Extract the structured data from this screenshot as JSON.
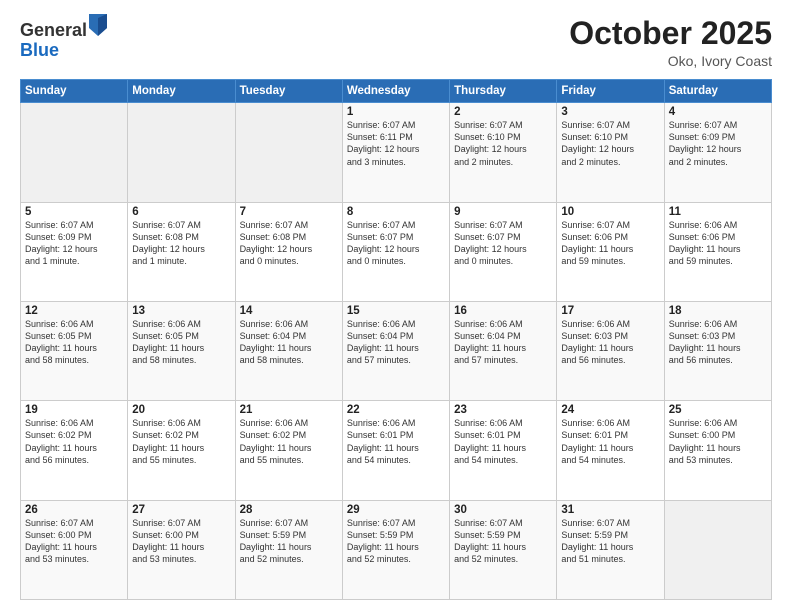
{
  "header": {
    "logo_general": "General",
    "logo_blue": "Blue",
    "month": "October 2025",
    "location": "Oko, Ivory Coast"
  },
  "days_of_week": [
    "Sunday",
    "Monday",
    "Tuesday",
    "Wednesday",
    "Thursday",
    "Friday",
    "Saturday"
  ],
  "weeks": [
    [
      {
        "day": "",
        "info": ""
      },
      {
        "day": "",
        "info": ""
      },
      {
        "day": "",
        "info": ""
      },
      {
        "day": "1",
        "info": "Sunrise: 6:07 AM\nSunset: 6:11 PM\nDaylight: 12 hours\nand 3 minutes."
      },
      {
        "day": "2",
        "info": "Sunrise: 6:07 AM\nSunset: 6:10 PM\nDaylight: 12 hours\nand 2 minutes."
      },
      {
        "day": "3",
        "info": "Sunrise: 6:07 AM\nSunset: 6:10 PM\nDaylight: 12 hours\nand 2 minutes."
      },
      {
        "day": "4",
        "info": "Sunrise: 6:07 AM\nSunset: 6:09 PM\nDaylight: 12 hours\nand 2 minutes."
      }
    ],
    [
      {
        "day": "5",
        "info": "Sunrise: 6:07 AM\nSunset: 6:09 PM\nDaylight: 12 hours\nand 1 minute."
      },
      {
        "day": "6",
        "info": "Sunrise: 6:07 AM\nSunset: 6:08 PM\nDaylight: 12 hours\nand 1 minute."
      },
      {
        "day": "7",
        "info": "Sunrise: 6:07 AM\nSunset: 6:08 PM\nDaylight: 12 hours\nand 0 minutes."
      },
      {
        "day": "8",
        "info": "Sunrise: 6:07 AM\nSunset: 6:07 PM\nDaylight: 12 hours\nand 0 minutes."
      },
      {
        "day": "9",
        "info": "Sunrise: 6:07 AM\nSunset: 6:07 PM\nDaylight: 12 hours\nand 0 minutes."
      },
      {
        "day": "10",
        "info": "Sunrise: 6:07 AM\nSunset: 6:06 PM\nDaylight: 11 hours\nand 59 minutes."
      },
      {
        "day": "11",
        "info": "Sunrise: 6:06 AM\nSunset: 6:06 PM\nDaylight: 11 hours\nand 59 minutes."
      }
    ],
    [
      {
        "day": "12",
        "info": "Sunrise: 6:06 AM\nSunset: 6:05 PM\nDaylight: 11 hours\nand 58 minutes."
      },
      {
        "day": "13",
        "info": "Sunrise: 6:06 AM\nSunset: 6:05 PM\nDaylight: 11 hours\nand 58 minutes."
      },
      {
        "day": "14",
        "info": "Sunrise: 6:06 AM\nSunset: 6:04 PM\nDaylight: 11 hours\nand 58 minutes."
      },
      {
        "day": "15",
        "info": "Sunrise: 6:06 AM\nSunset: 6:04 PM\nDaylight: 11 hours\nand 57 minutes."
      },
      {
        "day": "16",
        "info": "Sunrise: 6:06 AM\nSunset: 6:04 PM\nDaylight: 11 hours\nand 57 minutes."
      },
      {
        "day": "17",
        "info": "Sunrise: 6:06 AM\nSunset: 6:03 PM\nDaylight: 11 hours\nand 56 minutes."
      },
      {
        "day": "18",
        "info": "Sunrise: 6:06 AM\nSunset: 6:03 PM\nDaylight: 11 hours\nand 56 minutes."
      }
    ],
    [
      {
        "day": "19",
        "info": "Sunrise: 6:06 AM\nSunset: 6:02 PM\nDaylight: 11 hours\nand 56 minutes."
      },
      {
        "day": "20",
        "info": "Sunrise: 6:06 AM\nSunset: 6:02 PM\nDaylight: 11 hours\nand 55 minutes."
      },
      {
        "day": "21",
        "info": "Sunrise: 6:06 AM\nSunset: 6:02 PM\nDaylight: 11 hours\nand 55 minutes."
      },
      {
        "day": "22",
        "info": "Sunrise: 6:06 AM\nSunset: 6:01 PM\nDaylight: 11 hours\nand 54 minutes."
      },
      {
        "day": "23",
        "info": "Sunrise: 6:06 AM\nSunset: 6:01 PM\nDaylight: 11 hours\nand 54 minutes."
      },
      {
        "day": "24",
        "info": "Sunrise: 6:06 AM\nSunset: 6:01 PM\nDaylight: 11 hours\nand 54 minutes."
      },
      {
        "day": "25",
        "info": "Sunrise: 6:06 AM\nSunset: 6:00 PM\nDaylight: 11 hours\nand 53 minutes."
      }
    ],
    [
      {
        "day": "26",
        "info": "Sunrise: 6:07 AM\nSunset: 6:00 PM\nDaylight: 11 hours\nand 53 minutes."
      },
      {
        "day": "27",
        "info": "Sunrise: 6:07 AM\nSunset: 6:00 PM\nDaylight: 11 hours\nand 53 minutes."
      },
      {
        "day": "28",
        "info": "Sunrise: 6:07 AM\nSunset: 5:59 PM\nDaylight: 11 hours\nand 52 minutes."
      },
      {
        "day": "29",
        "info": "Sunrise: 6:07 AM\nSunset: 5:59 PM\nDaylight: 11 hours\nand 52 minutes."
      },
      {
        "day": "30",
        "info": "Sunrise: 6:07 AM\nSunset: 5:59 PM\nDaylight: 11 hours\nand 52 minutes."
      },
      {
        "day": "31",
        "info": "Sunrise: 6:07 AM\nSunset: 5:59 PM\nDaylight: 11 hours\nand 51 minutes."
      },
      {
        "day": "",
        "info": ""
      }
    ]
  ]
}
